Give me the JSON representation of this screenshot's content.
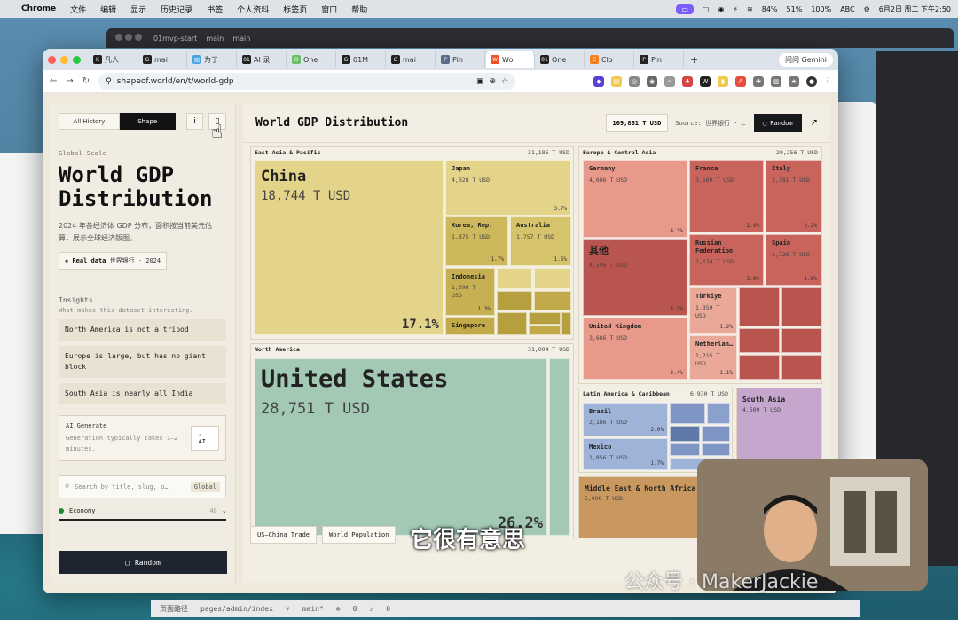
{
  "menubar": {
    "app": "Chrome",
    "items": [
      "文件",
      "编辑",
      "显示",
      "历史记录",
      "书签",
      "个人资料",
      "标签页",
      "窗口",
      "帮助"
    ],
    "status": {
      "mem": "84%",
      "cpu": "51%",
      "battery": "100%",
      "input": "ABC",
      "datetime": "6月2日 周二 下午2:50"
    }
  },
  "back_window": {
    "title": "01mvp-start",
    "branch": "main",
    "path": "main"
  },
  "ide_status": {
    "breadcrumb": "页面路径",
    "path": "pages/admin/index",
    "branch": "main*",
    "errors": "0",
    "warnings": "0"
  },
  "browser": {
    "tabs": [
      {
        "label": "凡人",
        "icon": "K"
      },
      {
        "label": "mai",
        "icon": "G"
      },
      {
        "label": "为了",
        "icon": "图"
      },
      {
        "label": "AI 录",
        "icon": "01"
      },
      {
        "label": "One",
        "icon": "O"
      },
      {
        "label": "01M",
        "icon": "G"
      },
      {
        "label": "mai",
        "icon": "G"
      },
      {
        "label": "Pin",
        "icon": "P"
      },
      {
        "label": "Wo",
        "icon": "W"
      },
      {
        "label": "One",
        "icon": "01"
      },
      {
        "label": "Clo",
        "icon": "C"
      },
      {
        "label": "Pin",
        "icon": "P"
      }
    ],
    "gemini": "问问 Gemini",
    "url": "shapeof.world/en/t/world-gdp"
  },
  "sidebar": {
    "toggle_history": "All History",
    "toggle_shape": "Shape",
    "info_icon": "i",
    "scale_label": "Global Scale",
    "title": "World GDP Distribution",
    "description": "2024 年各经济体 GDP 分布，面积按当前美元估算，展示全球经济版图。",
    "badge_label": "Real data",
    "badge_source": "世界银行 · 2024",
    "insights_title": "Insights",
    "insights_subtitle": "What makes this dataset interesting.",
    "insights": [
      "North America is not a tripod",
      "Europe is large, but has no giant block",
      "South Asia is nearly all India"
    ],
    "generate_title": "AI Generate",
    "generate_desc": "Generation typically takes 1–2 minutes.",
    "ai_button": "AI",
    "search_placeholder": "Search by title, slug, o…",
    "search_scope": "Global",
    "category": "Economy",
    "category_count": "48",
    "random_button": "Random"
  },
  "main": {
    "title": "World GDP Distribution",
    "total": "109,861 T USD",
    "source": "Source: 世界银行 · …",
    "random_button": "Random",
    "regions": [
      {
        "name": "East Asia & Pacific",
        "value": "31,186 T USD"
      },
      {
        "name": "Europe & Central Asia",
        "value": "29,256 T USD"
      },
      {
        "name": "North America",
        "value": "31,004 T USD"
      },
      {
        "name": "Latin America & Caribbean",
        "value": "6,930 T USD"
      },
      {
        "name": "Middle East & North Africa",
        "value": "5,008 T USD"
      },
      {
        "name": "South Asia",
        "value": "4,509 T USD"
      }
    ],
    "countries": {
      "china": {
        "name": "China",
        "value": "18,744 T USD",
        "pct": "17.1%"
      },
      "japan": {
        "name": "Japan",
        "value": "4,028 T USD",
        "pct": "3.7%"
      },
      "korea": {
        "name": "Korea, Rep.",
        "value": "1,875 T USD",
        "pct": "1.7%"
      },
      "australia": {
        "name": "Australia",
        "value": "1,757 T USD",
        "pct": "1.6%"
      },
      "indonesia": {
        "name": "Indonesia",
        "value": "1,396 T USD",
        "pct": "1.3%"
      },
      "singapore": {
        "name": "Singapore"
      },
      "us": {
        "name": "United States",
        "value": "28,751 T USD",
        "pct": "26.2%"
      },
      "germany": {
        "name": "Germany",
        "value": "4,686 T USD",
        "pct": "4.3%"
      },
      "france": {
        "name": "France",
        "value": "3,160 T USD",
        "pct": "2.9%"
      },
      "italy": {
        "name": "Italy",
        "value": "2,381 T USD",
        "pct": "2.2%"
      },
      "other": {
        "name": "其他",
        "value": "4,596 T USD",
        "pct": "4.2%"
      },
      "russia": {
        "name": "Russian Federation",
        "value": "2,174 T USD",
        "pct": "2.0%"
      },
      "spain": {
        "name": "Spain",
        "value": "1,726 T USD",
        "pct": "1.6%"
      },
      "uk": {
        "name": "United Kingdom",
        "value": "3,686 T USD",
        "pct": "3.4%"
      },
      "turkiye": {
        "name": "Türkiye",
        "value": "1,359 T USD",
        "pct": "1.2%"
      },
      "netherlands": {
        "name": "Netherlan…",
        "value": "1,215 T USD",
        "pct": "1.1%"
      },
      "brazil": {
        "name": "Brazil",
        "value": "2,186 T USD",
        "pct": "2.0%"
      },
      "mexico": {
        "name": "Mexico",
        "value": "1,856 T USD",
        "pct": "1.7%"
      }
    },
    "links": [
      "US–China Trade",
      "World Population"
    ]
  },
  "overlay": {
    "subtitle": "它很有意思",
    "watermark": "公众号 · MakerJackie"
  },
  "colors": {
    "asia": "#e3d489",
    "asia_dark": "#b59f3e",
    "na": "#a3c9b5",
    "europe": "#e8998a",
    "europe_dark": "#b9554f",
    "latam": "#9fb3d9",
    "mena": "#c9985f",
    "south_asia": "#c5a7cd"
  }
}
